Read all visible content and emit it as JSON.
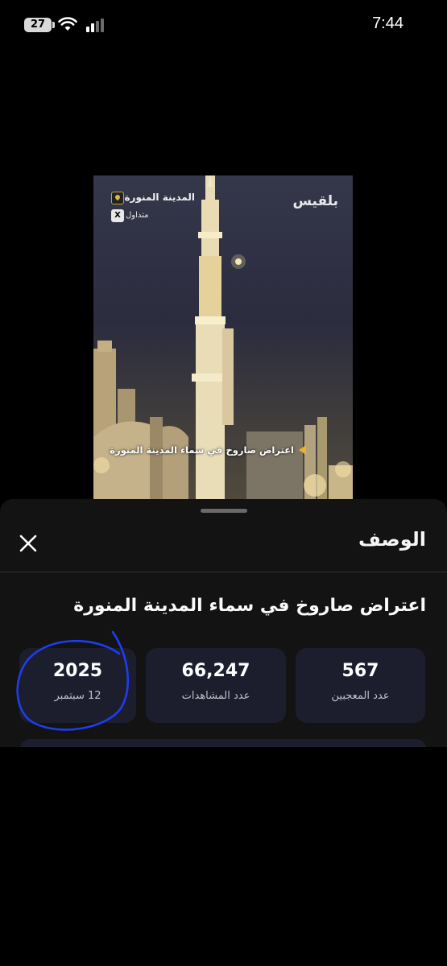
{
  "status_bar": {
    "battery": "27",
    "time": "7:44"
  },
  "video": {
    "location": "المدينة المنورة",
    "trending": "متداول",
    "x_badge": "X",
    "brand": "بلقيس",
    "caption": "اعتراض صاروخ في سماء المدينة المنورة"
  },
  "sheet": {
    "title": "الوصف",
    "close_label": "✕",
    "description": "اعتراض صاروخ في سماء المدينة المنورة",
    "stats": [
      {
        "value": "567",
        "label": "عدد المعجبين"
      },
      {
        "value": "66,247",
        "label": "عدد المشاهدات"
      },
      {
        "value": "2025",
        "label": "12 سبتمبر"
      }
    ]
  },
  "colors": {
    "sheet_bg": "#131313",
    "card_bg": "#1c1e2d",
    "annotation": "#1f3df0"
  }
}
